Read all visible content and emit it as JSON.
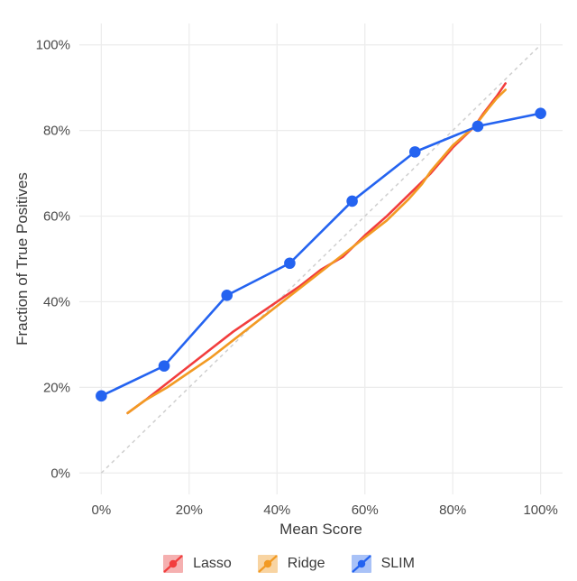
{
  "chart_data": {
    "type": "line",
    "title": "",
    "xlabel": "Mean Score",
    "ylabel": "Fraction of True Positives",
    "xlim": [
      -5,
      105
    ],
    "ylim": [
      -5,
      105
    ],
    "x_ticks": [
      0,
      20,
      40,
      60,
      80,
      100
    ],
    "y_ticks": [
      0,
      20,
      40,
      60,
      80,
      100
    ],
    "x_tick_labels": [
      "0%",
      "20%",
      "40%",
      "60%",
      "80%",
      "100%"
    ],
    "y_tick_labels": [
      "0%",
      "20%",
      "40%",
      "60%",
      "80%",
      "100%"
    ],
    "diagonal": {
      "x0": 0,
      "y0": 0,
      "x1": 100,
      "y1": 100
    },
    "series": [
      {
        "name": "Lasso",
        "color": "#F23D3D",
        "fill": "#F5B0B0",
        "points_visible": false,
        "x": [
          6,
          10,
          15,
          20,
          25,
          30,
          35,
          40,
          45,
          50,
          55,
          60,
          65,
          70,
          75,
          80,
          85,
          87,
          90,
          92
        ],
        "y": [
          14,
          17,
          21,
          25,
          29,
          33,
          36.5,
          40,
          43.5,
          47.5,
          50.5,
          55.5,
          60,
          65,
          70,
          76,
          81,
          84,
          88,
          91
        ]
      },
      {
        "name": "Ridge",
        "color": "#F29A23",
        "fill": "#F8D4A2",
        "points_visible": false,
        "x": [
          6,
          10,
          15,
          20,
          25,
          30,
          35,
          40,
          45,
          50,
          55,
          60,
          65,
          70,
          73,
          75,
          80,
          85,
          88,
          90,
          92
        ],
        "y": [
          14,
          17,
          20,
          23.5,
          27,
          31,
          35,
          39,
          43,
          47,
          51,
          55,
          59,
          64,
          67.5,
          70.5,
          76.5,
          81,
          85,
          87.5,
          89.5
        ]
      },
      {
        "name": "SLIM",
        "color": "#2463F0",
        "fill": "#A9C2F7",
        "points_visible": true,
        "x": [
          0,
          14.3,
          28.6,
          42.9,
          57.1,
          71.4,
          85.7,
          100
        ],
        "y": [
          18,
          25,
          41.5,
          49,
          63.5,
          75,
          81,
          84
        ]
      }
    ],
    "legend": {
      "position": "bottom",
      "items": [
        "Lasso",
        "Ridge",
        "SLIM"
      ]
    }
  }
}
